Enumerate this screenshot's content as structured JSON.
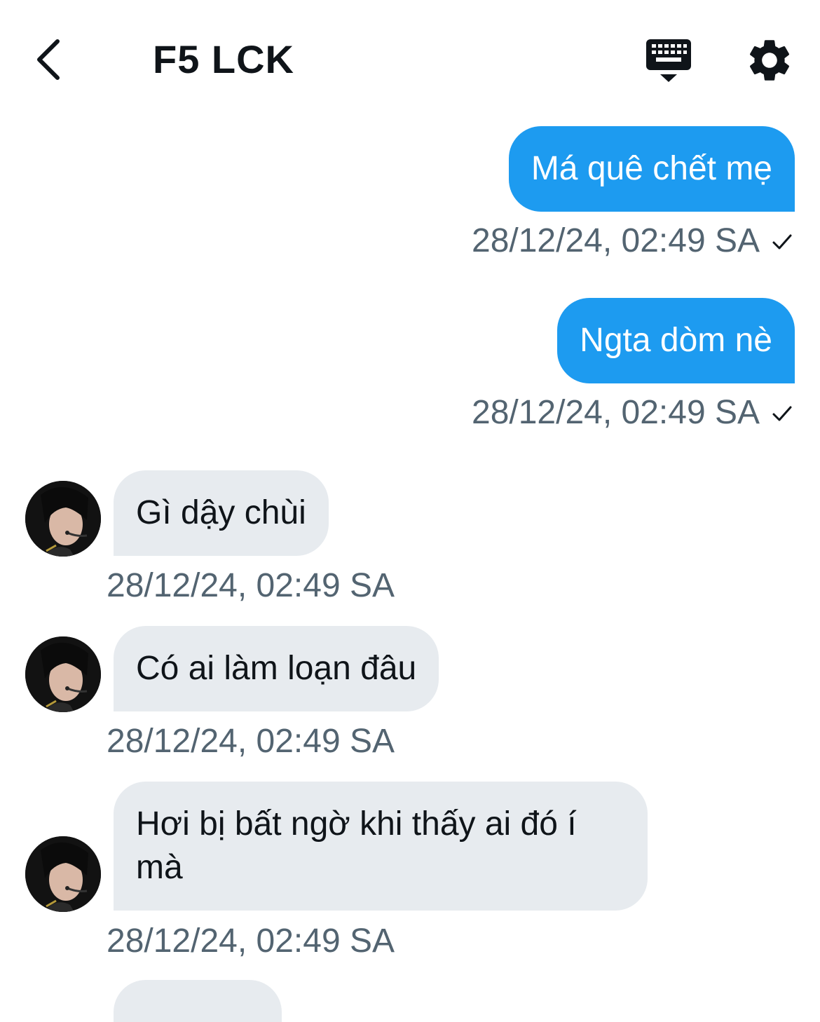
{
  "header": {
    "title": "F5 LCK",
    "back_icon": "chevron-left-icon",
    "keyboard_icon": "keyboard-icon",
    "settings_icon": "gear-icon"
  },
  "colors": {
    "outgoing_bubble": "#1d9bf0",
    "incoming_bubble": "#e7ebef",
    "timestamp": "#536471",
    "text": "#0f1419"
  },
  "messages": [
    {
      "direction": "outgoing",
      "text": "Má quê chết mẹ",
      "timestamp": "28/12/24, 02:49 SA",
      "sent": true
    },
    {
      "direction": "outgoing",
      "text": "Ngta dòm nè",
      "timestamp": "28/12/24, 02:49 SA",
      "sent": true
    },
    {
      "direction": "incoming",
      "text": "Gì dậy chùi",
      "timestamp": "28/12/24, 02:49 SA"
    },
    {
      "direction": "incoming",
      "text": "Có ai làm loạn đâu",
      "timestamp": "28/12/24, 02:49 SA"
    },
    {
      "direction": "incoming",
      "text": "Hơi bị bất ngờ khi thấy ai đó í mà",
      "timestamp": "28/12/24, 02:49 SA"
    }
  ]
}
